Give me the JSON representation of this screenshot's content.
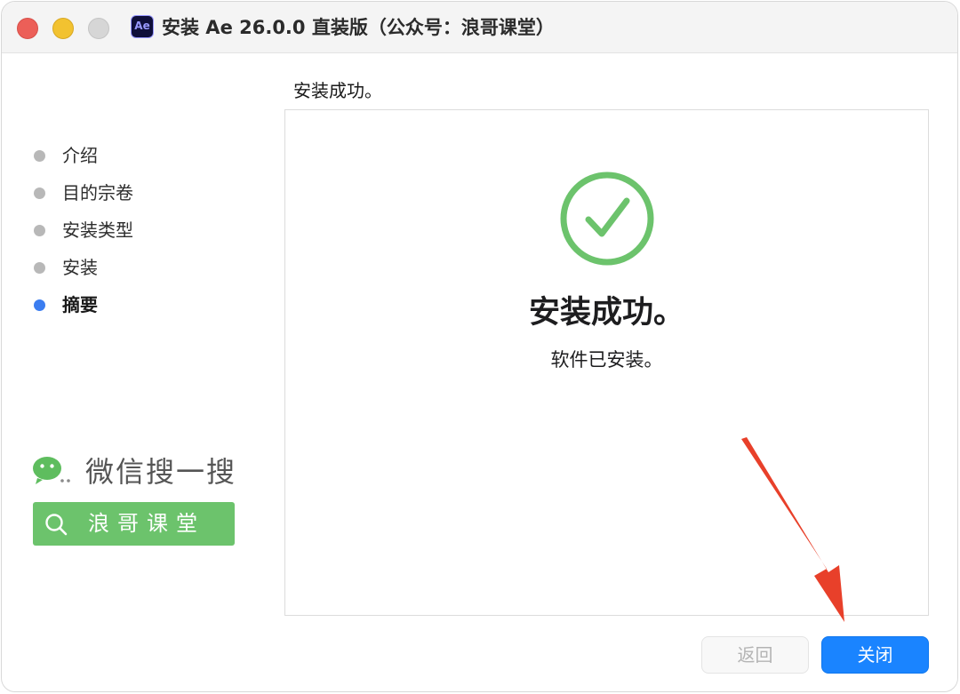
{
  "window": {
    "title": "安装 Ae 26.0.0 直装版（公众号：浪哥课堂）",
    "app_icon_label": "Ae"
  },
  "sidebar": {
    "steps": [
      {
        "label": "介绍",
        "active": false
      },
      {
        "label": "目的宗卷",
        "active": false
      },
      {
        "label": "安装类型",
        "active": false
      },
      {
        "label": "安装",
        "active": false
      },
      {
        "label": "摘要",
        "active": true
      }
    ],
    "wechat_search_text": "微信搜一搜",
    "search_box_text": "浪哥课堂"
  },
  "main": {
    "section_title": "安装成功。",
    "success_heading": "安装成功。",
    "success_subtext": "软件已安装。"
  },
  "footer": {
    "back_label": "返回",
    "close_label": "关闭"
  },
  "colors": {
    "accent_blue": "#1a84ff",
    "success_green": "#6cc36c",
    "arrow_red": "#e8402a"
  }
}
